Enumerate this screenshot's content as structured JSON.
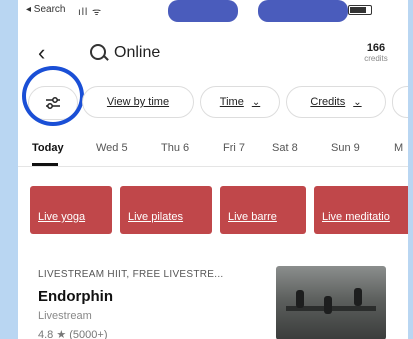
{
  "status": {
    "back_app": "◂ Search",
    "signal": "ıll ᯤ"
  },
  "header": {
    "back_icon": "‹",
    "search_value": "Online",
    "credits_value": "166",
    "credits_label": "credits"
  },
  "filters": {
    "icon": "settings-sliders-icon",
    "chips": [
      {
        "label": "View by time"
      },
      {
        "label": "Time",
        "chevron": "chevron-down-icon"
      },
      {
        "label": "Credits",
        "chevron": "chevron-down-icon"
      }
    ]
  },
  "days": [
    "Today",
    "Wed 5",
    "Thu 6",
    "Fri 7",
    "Sat 8",
    "Sun 9",
    "M"
  ],
  "categories": [
    "Live yoga",
    "Live pilates",
    "Live barre",
    "Live meditatio"
  ],
  "card": {
    "tag": "LIVESTREAM HIIT, FREE LIVESTRE...",
    "title": "Endorphin",
    "subtitle": "Livestream",
    "rating": "4.8 ★ (5000+)"
  },
  "colors": {
    "category_bg": "#c0474a",
    "annotation": "#1a4fd6",
    "background": "#b9d6f2"
  }
}
